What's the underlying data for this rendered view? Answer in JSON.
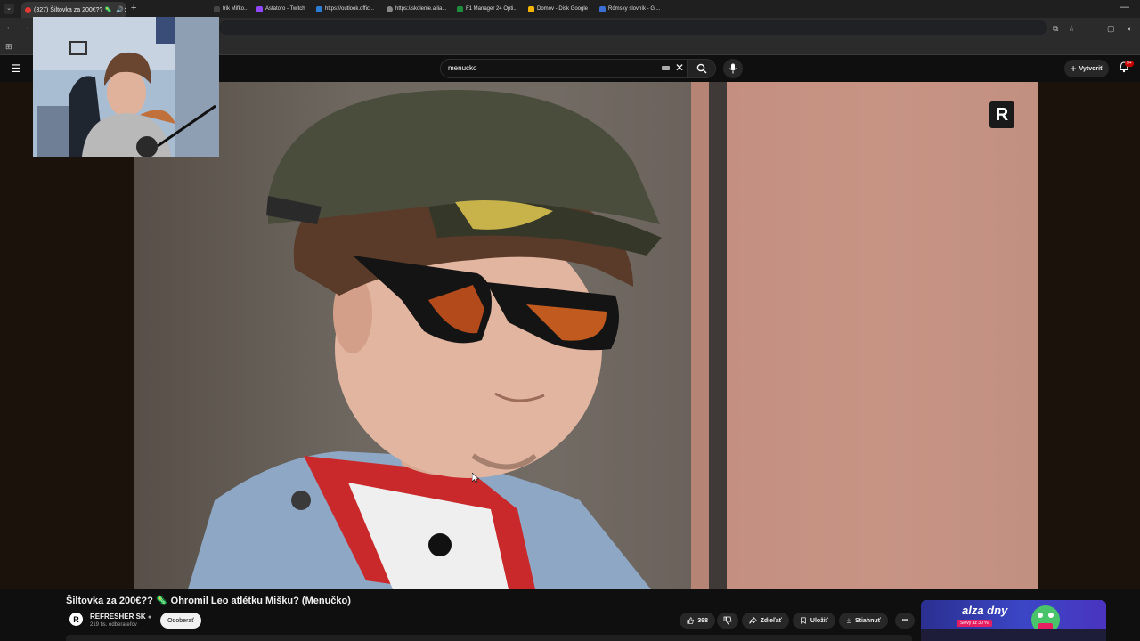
{
  "browser": {
    "tab_title": "(327) Šiltovka za 200€?? 🦠",
    "bookmarks": [
      {
        "label": "trik Mifko...",
        "color": "#444444"
      },
      {
        "label": "Astatoro - Twitch",
        "color": "#9146ff"
      },
      {
        "label": "https://outlook.offic...",
        "color": "#2b7cd3"
      },
      {
        "label": "https://skolenie.allia...",
        "color": "#888888"
      },
      {
        "label": "F1 Manager 24 Opti...",
        "color": "#1e8e3e"
      },
      {
        "label": "Domov - Disk Google",
        "color": "#f4b400"
      },
      {
        "label": "Rómsky slovník - Gl...",
        "color": "#3b6fd4"
      }
    ]
  },
  "youtube": {
    "search_query": "menucko",
    "create_label": "Vytvoriť",
    "notifications_badge": "9+"
  },
  "video": {
    "title": "Šiltovka za 200€?? 🦠 Ohromil Leo atlétku Mišku? (Menučko)",
    "channel_name": "REFRESHER SK",
    "channel_avatar_letter": "R",
    "subscribers": "219 tis. odberateľov",
    "subscribe_label": "Odoberať",
    "like_count": "398",
    "share_label": "Zdieľať",
    "save_label": "Uložiť",
    "download_label": "Stiahnuť",
    "more_label": "•••",
    "watermark_letter": "R"
  },
  "ad": {
    "title": "alza dny",
    "subtitle": "Slevy až 30 %"
  }
}
